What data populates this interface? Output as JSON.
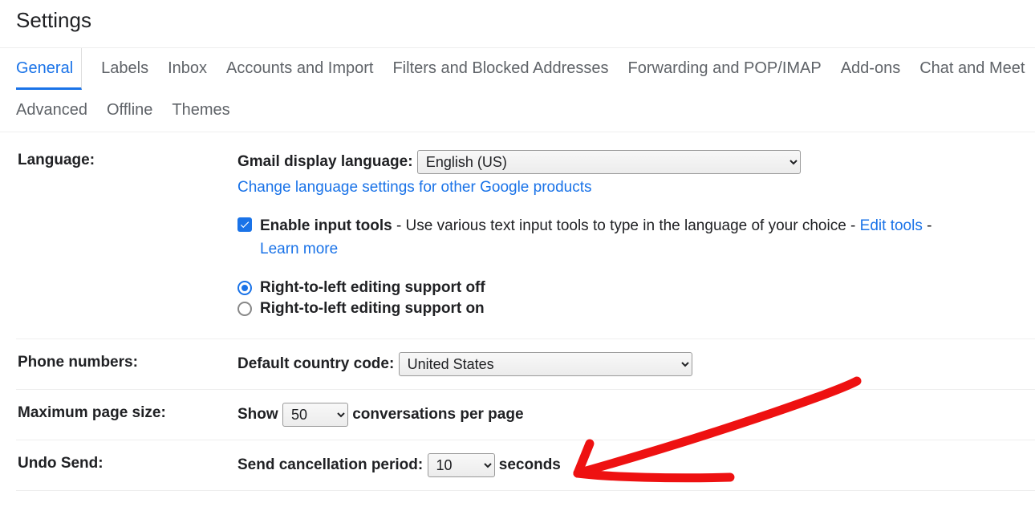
{
  "page_title": "Settings",
  "tabs": [
    "General",
    "Labels",
    "Inbox",
    "Accounts and Import",
    "Filters and Blocked Addresses",
    "Forwarding and POP/IMAP",
    "Add-ons",
    "Chat and Meet",
    "Advanced",
    "Offline",
    "Themes"
  ],
  "active_tab_index": 0,
  "language": {
    "section_label": "Language:",
    "display_label": "Gmail display language:",
    "selected": "English (US)",
    "change_link": "Change language settings for other Google products",
    "enable_input_tools_label": "Enable input tools",
    "enable_input_tools_desc": " - Use various text input tools to type in the language of your choice - ",
    "edit_tools_link": "Edit tools",
    "dash_sep": " - ",
    "learn_more_link": "Learn more",
    "rtl_off_label": "Right-to-left editing support off",
    "rtl_on_label": "Right-to-left editing support on",
    "rtl_selected": "off"
  },
  "phone": {
    "section_label": "Phone numbers:",
    "country_label": "Default country code:",
    "selected": "United States"
  },
  "page_size": {
    "section_label": "Maximum page size:",
    "prefix": "Show",
    "selected": "50",
    "suffix": "conversations per page"
  },
  "undo_send": {
    "section_label": "Undo Send:",
    "prefix": "Send cancellation period:",
    "selected": "10",
    "suffix": "seconds"
  }
}
